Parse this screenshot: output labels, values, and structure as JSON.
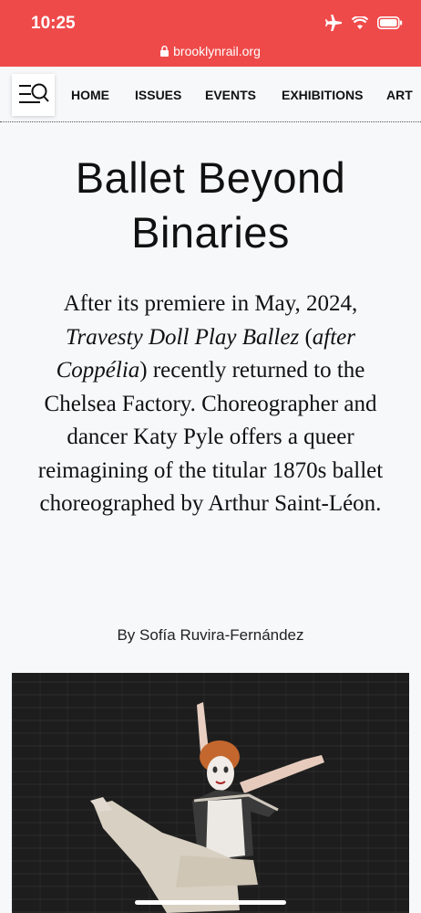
{
  "status_bar": {
    "time": "10:25",
    "icons": [
      "airplane-icon",
      "wifi-icon",
      "battery-icon"
    ]
  },
  "browser": {
    "url": "brooklynrail.org"
  },
  "nav": {
    "items": [
      "HOME",
      "ISSUES",
      "EVENTS",
      "EXHIBITIONS",
      "ART"
    ]
  },
  "article": {
    "title_line1": "Ballet Beyond",
    "title_line2": "Binaries",
    "dek": {
      "part1": "After its premiere in May, 2024, ",
      "italic1": "Travesty Doll Play Ballez",
      "part2": " (",
      "italic2": "after Coppélia",
      "part3": ") recently returned to the Chelsea Factory. Choreographer and dancer Katy Pyle offers a queer reimagining of the titular 1870s ballet choreographed by Arthur Saint-Léon."
    },
    "byline": "By Sofía Ruvira-Fernández"
  },
  "colors": {
    "topbar": "#ef4a4a",
    "background": "#f7f8fa",
    "text": "#111111"
  }
}
